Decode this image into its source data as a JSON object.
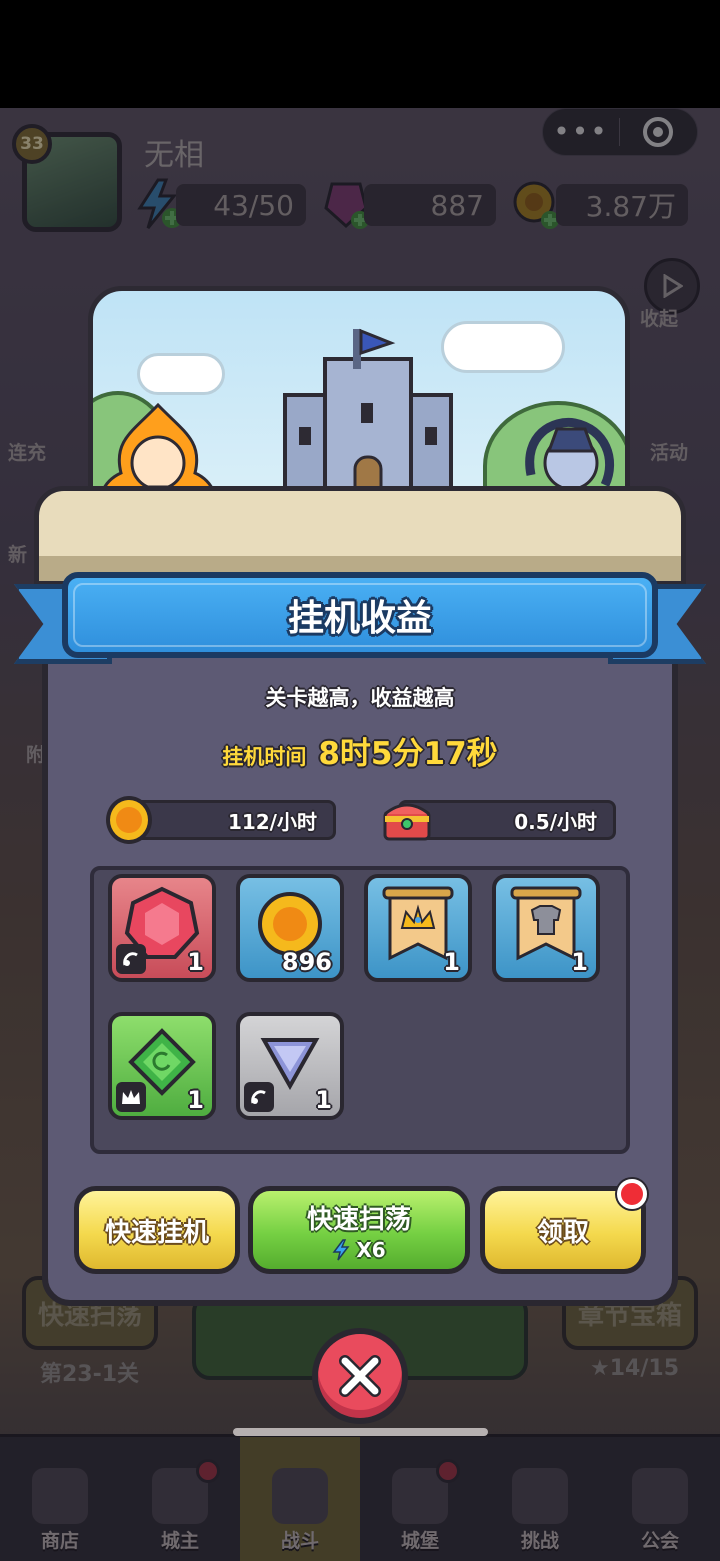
{
  "hud": {
    "player_level": "33",
    "player_name": "无相",
    "energy": "43/50",
    "gems": "887",
    "gold": "3.87万"
  },
  "side_buttons": {
    "collapse": "收起",
    "left_top": "连充",
    "left_mid": "新",
    "left_low": "附",
    "right_top": "活动"
  },
  "background_bottom": {
    "quick_sweep_btn": "快速扫荡",
    "chapter_chest_btn": "章节宝箱",
    "stage": "第23-1关",
    "stars": "14/15"
  },
  "bottom_nav": [
    {
      "label": "商店",
      "has_dot": false
    },
    {
      "label": "城主",
      "has_dot": true
    },
    {
      "label": "战斗",
      "has_dot": false
    },
    {
      "label": "城堡",
      "has_dot": true
    },
    {
      "label": "挑战",
      "has_dot": false
    },
    {
      "label": "公会",
      "has_dot": false
    }
  ],
  "dialog": {
    "title": "挂机收益",
    "hint": "关卡越高，收益越高",
    "idle_time_label": "挂机时间",
    "idle_time_value": "8时5分17秒",
    "gold_rate": "112/小时",
    "chest_rate": "0.5/小时",
    "rewards": [
      {
        "icon": "ruby-gem-icon",
        "count": "1",
        "bg": "#d9626d",
        "tag": "fragment-icon"
      },
      {
        "icon": "gold-coin-icon",
        "count": "896",
        "bg": "#5aaad6",
        "tag": null
      },
      {
        "icon": "crown-banner-icon",
        "count": "1",
        "bg": "#5aaad6",
        "tag": null
      },
      {
        "icon": "armor-banner-icon",
        "count": "1",
        "bg": "#5aaad6",
        "tag": null
      },
      {
        "icon": "green-rune-icon",
        "count": "1",
        "bg": "#6cc657",
        "tag": "crown-icon"
      },
      {
        "icon": "diamond-shard-icon",
        "count": "1",
        "bg": "#bcbcc0",
        "tag": "fragment-icon"
      }
    ],
    "buttons": {
      "quick_idle": "快速挂机",
      "quick_sweep": "快速扫荡",
      "quick_sweep_cost": "X6",
      "claim": "领取"
    }
  }
}
